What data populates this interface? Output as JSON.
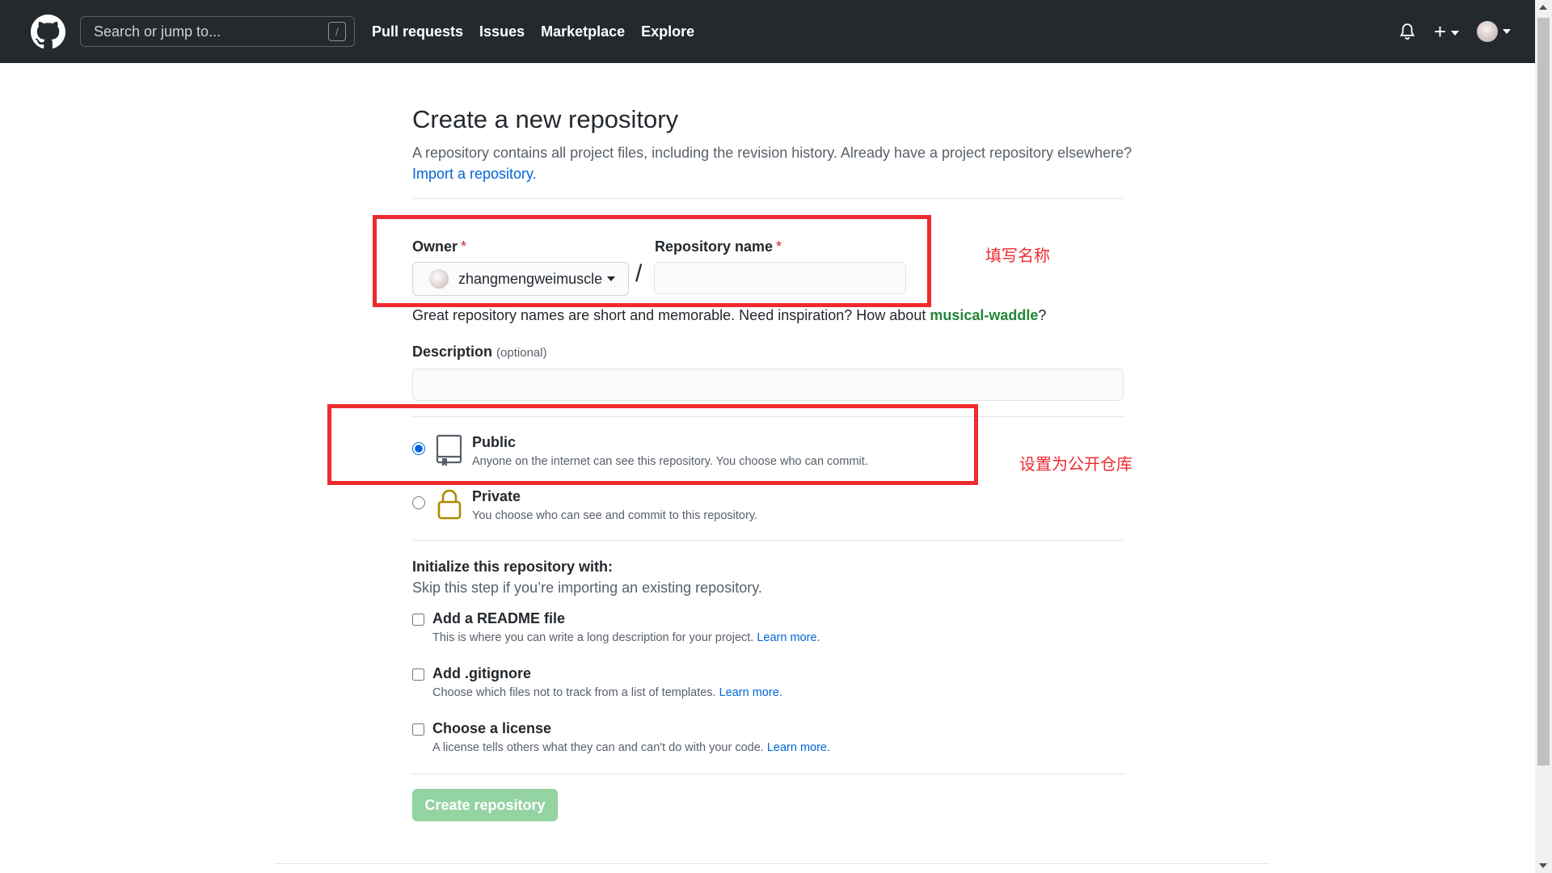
{
  "header": {
    "search_placeholder": "Search or jump to...",
    "slash_key": "/",
    "nav": [
      "Pull requests",
      "Issues",
      "Marketplace",
      "Explore"
    ],
    "plus_symbol": "+"
  },
  "page": {
    "title": "Create a new repository",
    "subtitle": "A repository contains all project files, including the revision history. Already have a project repository elsewhere?",
    "import_link": "Import a repository."
  },
  "form": {
    "owner_label": "Owner",
    "required_mark": "*",
    "owner_value": "zhangmengweimuscle",
    "slash": "/",
    "repo_label": "Repository name",
    "repo_value": "",
    "hint_prefix": "Great repository names are short and memorable. Need inspiration? How about",
    "hint_suggestion": "musical-waddle",
    "hint_suffix": "?",
    "description_label": "Description",
    "description_optional": "(optional)",
    "description_value": ""
  },
  "visibility": {
    "selected": "public",
    "public_title": "Public",
    "public_desc": "Anyone on the internet can see this repository. You choose who can commit.",
    "private_title": "Private",
    "private_desc": "You choose who can see and commit to this repository."
  },
  "init": {
    "title": "Initialize this repository with:",
    "subtitle": "Skip this step if you’re importing an existing repository.",
    "options": [
      {
        "title": "Add a README file",
        "desc": "This is where you can write a long description for your project.",
        "link": "Learn more.",
        "checked": false
      },
      {
        "title": "Add .gitignore",
        "desc": "Choose which files not to track from a list of templates.",
        "link": "Learn more.",
        "checked": false
      },
      {
        "title": "Choose a license",
        "desc": "A license tells others what they can and can't do with your code.",
        "link": "Learn more.",
        "checked": false
      }
    ]
  },
  "submit_label": "Create repository",
  "annotations": {
    "name_note": "填写名称",
    "public_note": "设置为公开仓库",
    "color": "#ee2b30"
  }
}
